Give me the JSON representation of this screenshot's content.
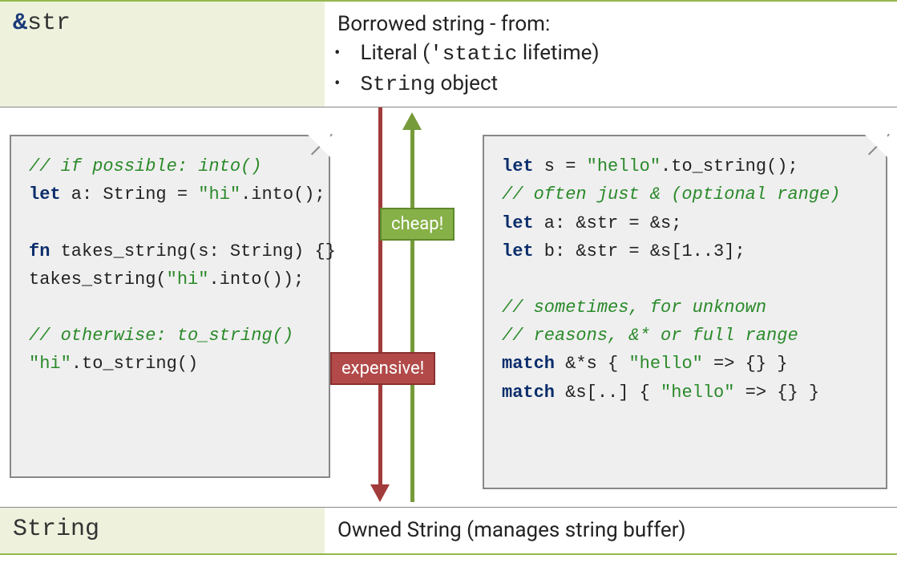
{
  "top": {
    "type_amp": "&",
    "type_name": "str",
    "desc_title": "Borrowed string - from:",
    "bullet1_pre": "Literal (",
    "bullet1_code": "'static",
    "bullet1_post": " lifetime)",
    "bullet2_code": "String",
    "bullet2_post": " object"
  },
  "left_code": {
    "c1": "// if possible: into()",
    "l2_kw": "let",
    "l2_rest": " a: String = ",
    "l2_str": "\"hi\"",
    "l2_end": ".into();",
    "l4_kw": "fn",
    "l4_rest": " takes_string(s: String) {}",
    "l5_a": "takes_string(",
    "l5_str": "\"hi\"",
    "l5_b": ".into());",
    "c2": "// otherwise: to_string()",
    "l8_str": "\"hi\"",
    "l8_rest": ".to_string()"
  },
  "right_code": {
    "l1_kw": "let",
    "l1_a": " s = ",
    "l1_str": "\"hello\"",
    "l1_b": ".to_string();",
    "c1": "// often just & (optional range)",
    "l3_kw": "let",
    "l3_rest": " a: &str = &s;",
    "l4_kw": "let",
    "l4_rest": " b: &str = &s[1..3];",
    "c2": "// sometimes, for unknown",
    "c3": "// reasons, &* or full range",
    "l8_kw": "match",
    "l8_a": " &*s { ",
    "l8_str": "\"hello\"",
    "l8_b": " => {} }",
    "l9_kw": "match",
    "l9_a": " &s[..] { ",
    "l9_str": "\"hello\"",
    "l9_b": " => {} }"
  },
  "badges": {
    "cheap": "cheap!",
    "expensive": "expensive!"
  },
  "bottom": {
    "type_name": "String",
    "desc": "Owned String (manages string buffer)"
  }
}
